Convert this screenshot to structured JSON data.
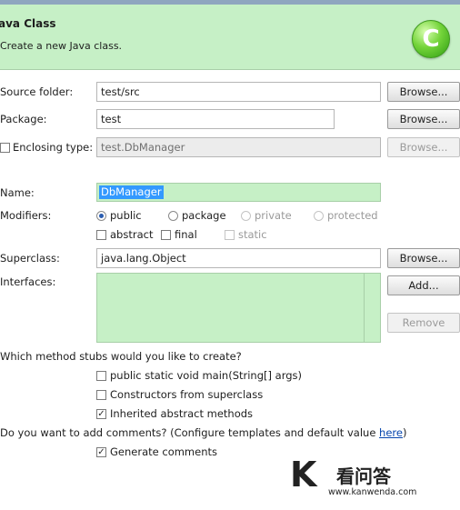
{
  "header": {
    "title": "ava Class",
    "subtitle": "Create a new Java class.",
    "logo_letter": "C"
  },
  "form": {
    "source_folder": {
      "label": "Source folder:",
      "value": "test/src",
      "button": "Browse..."
    },
    "package": {
      "label": "Package:",
      "value": "test",
      "button": "Browse..."
    },
    "enclosing_type": {
      "label": "Enclosing type:",
      "value": "test.DbManager",
      "button": "Browse..."
    },
    "name": {
      "label": "Name:",
      "value": "DbManager"
    },
    "modifiers": {
      "label": "Modifiers:",
      "radios": [
        "public",
        "package",
        "private",
        "protected"
      ],
      "checks": [
        "abstract",
        "final",
        "static"
      ]
    },
    "superclass": {
      "label": "Superclass:",
      "value": "java.lang.Object",
      "button": "Browse..."
    },
    "interfaces": {
      "label": "Interfaces:",
      "add_button": "Add...",
      "remove_button": "Remove"
    }
  },
  "stubs": {
    "question": "Which method stubs would you like to create?",
    "items": [
      "public static void main(String[] args)",
      "Constructors from superclass",
      "Inherited abstract methods"
    ]
  },
  "comments": {
    "question": "Do you want to add comments? (Configure templates and default value ",
    "link": "here",
    "close_paren": ")",
    "generate": "Generate comments"
  },
  "watermark": {
    "mark": "K",
    "name": "看问答",
    "url": "www.kanwenda.com"
  },
  "colors": {
    "header_bg": "#c6f0c6",
    "selection": "#3399ff",
    "link": "#0645ad"
  }
}
